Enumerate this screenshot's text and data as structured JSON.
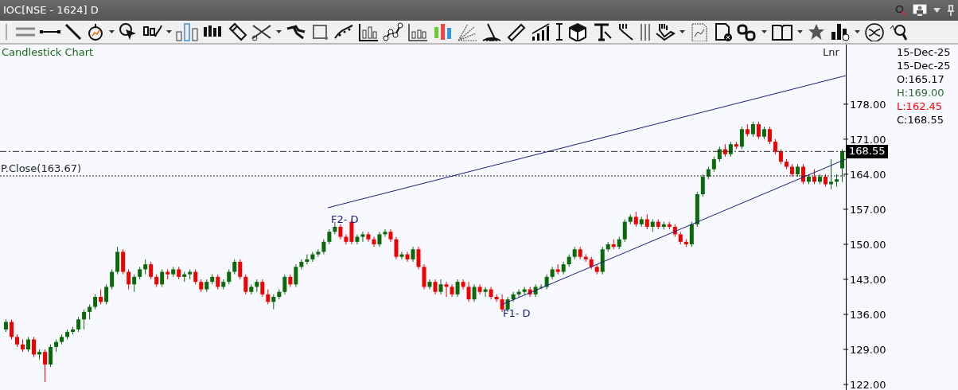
{
  "window": {
    "title": "IOC[NSE - 1624] D"
  },
  "chart": {
    "title": "Candlestick Chart",
    "scale_mode": "Lnr",
    "chart_data": {
      "type": "candlestick",
      "ylim": [
        120.9,
        189.9
      ],
      "ref_lines": [
        {
          "axis": "y",
          "value": 168.55
        },
        {
          "axis": "y",
          "value": 163.67
        }
      ],
      "yticks": [
        {
          "value": 178,
          "label": "178.00"
        },
        {
          "value": 171,
          "label": "171.00"
        },
        {
          "value": 164,
          "label": "164.00"
        },
        {
          "value": 157,
          "label": "157.00"
        },
        {
          "value": 150,
          "label": "150.00"
        },
        {
          "value": 143,
          "label": "143.00"
        },
        {
          "value": 136,
          "label": "136.00"
        },
        {
          "value": 129,
          "label": "129.00"
        },
        {
          "value": 122,
          "label": "122.00"
        }
      ],
      "ohlc": [
        [
          133,
          135,
          132.5,
          134.5
        ],
        [
          134.5,
          135,
          131,
          131.5
        ],
        [
          131.5,
          132,
          129.5,
          130
        ],
        [
          130,
          131,
          128.5,
          129
        ],
        [
          129,
          131.5,
          128.5,
          131
        ],
        [
          131,
          131.5,
          127.5,
          128
        ],
        [
          128,
          129,
          127,
          128.5
        ],
        [
          128.5,
          129,
          122.5,
          126
        ],
        [
          126,
          130,
          125.5,
          129.5
        ],
        [
          129.5,
          131,
          128.5,
          130.5
        ],
        [
          130.5,
          132,
          130,
          131.5
        ],
        [
          131.5,
          133,
          131,
          132.5
        ],
        [
          132.5,
          133.5,
          132,
          133
        ],
        [
          133,
          135.5,
          132.5,
          135
        ],
        [
          135,
          137,
          133,
          136.5
        ],
        [
          136.5,
          138,
          135,
          137.5
        ],
        [
          137.5,
          140,
          137,
          139.5
        ],
        [
          139.5,
          141,
          138,
          138.5
        ],
        [
          138.5,
          142,
          138,
          141.5
        ],
        [
          141.5,
          145,
          141,
          144.5
        ],
        [
          144.5,
          149.5,
          144,
          148.5
        ],
        [
          148.5,
          149,
          144,
          144.5
        ],
        [
          144.5,
          145,
          141,
          142
        ],
        [
          142,
          144,
          140.5,
          143.5
        ],
        [
          143.5,
          145.5,
          143,
          145
        ],
        [
          145,
          147,
          144,
          146
        ],
        [
          146,
          146.5,
          143,
          143.5
        ],
        [
          143.5,
          144,
          141.5,
          142
        ],
        [
          142,
          145,
          141.5,
          144.5
        ],
        [
          144.5,
          145,
          143,
          144
        ],
        [
          144,
          145.5,
          143.5,
          145
        ],
        [
          145,
          145.5,
          143,
          143.5
        ],
        [
          143.5,
          144.5,
          142.5,
          144
        ],
        [
          144,
          145,
          143,
          144.5
        ],
        [
          144.5,
          145,
          142,
          142.5
        ],
        [
          142.5,
          143,
          140.5,
          141
        ],
        [
          141,
          143,
          140.5,
          142.5
        ],
        [
          142.5,
          144,
          142,
          143.5
        ],
        [
          143.5,
          144,
          141,
          141.5
        ],
        [
          141.5,
          143,
          141,
          142.5
        ],
        [
          142.5,
          145,
          142,
          144.5
        ],
        [
          144.5,
          147,
          144,
          146.5
        ],
        [
          146.5,
          147,
          143,
          143.5
        ],
        [
          143.5,
          144,
          140,
          140.5
        ],
        [
          140.5,
          142,
          140,
          141.5
        ],
        [
          141.5,
          143,
          140.5,
          142.5
        ],
        [
          142.5,
          143,
          139.5,
          140
        ],
        [
          140,
          141,
          138,
          138.5
        ],
        [
          138.5,
          140,
          137,
          139.5
        ],
        [
          139.5,
          141,
          139,
          140.5
        ],
        [
          140.5,
          144,
          140,
          143.5
        ],
        [
          143.5,
          144,
          141.5,
          142
        ],
        [
          142,
          146,
          141.5,
          145.5
        ],
        [
          145.5,
          147,
          145,
          146.5
        ],
        [
          146.5,
          148,
          146,
          147
        ],
        [
          147,
          148.5,
          146.5,
          148
        ],
        [
          148,
          149,
          147.5,
          148.5
        ],
        [
          148.5,
          151,
          148,
          150.5
        ],
        [
          150.5,
          153,
          150,
          152.5
        ],
        [
          152.5,
          154.5,
          152,
          153.5
        ],
        [
          153.5,
          154,
          151,
          151.5
        ],
        [
          151.5,
          152,
          150,
          150.5
        ],
        [
          154.5,
          155,
          150,
          150.5
        ],
        [
          150.5,
          152,
          150,
          151.5
        ],
        [
          151.5,
          152.5,
          150.5,
          152
        ],
        [
          152,
          152.5,
          150.5,
          151
        ],
        [
          151,
          151.5,
          149.5,
          150
        ],
        [
          150,
          152.5,
          149.5,
          152
        ],
        [
          152,
          153,
          151.5,
          152.5
        ],
        [
          152.5,
          153,
          150.5,
          151
        ],
        [
          151,
          151.5,
          147,
          147.5
        ],
        [
          147.5,
          148.5,
          147,
          148
        ],
        [
          148,
          148.5,
          146.5,
          147
        ],
        [
          147,
          149.5,
          146.5,
          149
        ],
        [
          149,
          149.5,
          145,
          145.5
        ],
        [
          145.5,
          146,
          141,
          141.5
        ],
        [
          141.5,
          143,
          141,
          142.5
        ],
        [
          142.5,
          143,
          140,
          140.5
        ],
        [
          140.5,
          143,
          140,
          142
        ],
        [
          142,
          142.5,
          139.5,
          141.5
        ],
        [
          141.5,
          142,
          139.5,
          140
        ],
        [
          140,
          143,
          139.5,
          142.5
        ],
        [
          142.5,
          143,
          141,
          141.5
        ],
        [
          141.5,
          142.5,
          138.5,
          139
        ],
        [
          139,
          142,
          138.5,
          141.5
        ],
        [
          141.5,
          142,
          140,
          140.5
        ],
        [
          140.5,
          141.5,
          139.5,
          141
        ],
        [
          141,
          141.5,
          139,
          139.5
        ],
        [
          139.5,
          140,
          138.5,
          139
        ],
        [
          139,
          140,
          136.5,
          137
        ],
        [
          137,
          139.5,
          136.5,
          139
        ],
        [
          139,
          140.5,
          138.5,
          140
        ],
        [
          140,
          141,
          139.5,
          140.5
        ],
        [
          140.5,
          141.5,
          140,
          141
        ],
        [
          141,
          141.5,
          139.5,
          140
        ],
        [
          140,
          142,
          139.5,
          141.5
        ],
        [
          141.5,
          142,
          141,
          141.5
        ],
        [
          141.5,
          144,
          141,
          143.5
        ],
        [
          143.5,
          145.5,
          143,
          145
        ],
        [
          145,
          146,
          144,
          144.5
        ],
        [
          144.5,
          146.5,
          144,
          146
        ],
        [
          146,
          148,
          145.5,
          147.5
        ],
        [
          147.5,
          149.5,
          147,
          149
        ],
        [
          149,
          149.5,
          147,
          147.5
        ],
        [
          147.5,
          148,
          146.5,
          147
        ],
        [
          147,
          147.5,
          145,
          145.5
        ],
        [
          145.5,
          146,
          144,
          144.5
        ],
        [
          144.5,
          149.5,
          144,
          149
        ],
        [
          149,
          150.5,
          148.5,
          150
        ],
        [
          150,
          151,
          149,
          149.5
        ],
        [
          149.5,
          151.5,
          149,
          151
        ],
        [
          151,
          155,
          150.5,
          154.5
        ],
        [
          154.5,
          156,
          154,
          155.5
        ],
        [
          155.5,
          156.5,
          153.5,
          154
        ],
        [
          154,
          155.5,
          153.5,
          155
        ],
        [
          155,
          156,
          153,
          153.5
        ],
        [
          153.5,
          155,
          152.5,
          154.5
        ],
        [
          154.5,
          155,
          153,
          153.5
        ],
        [
          153.5,
          154.5,
          153,
          154
        ],
        [
          154,
          154.5,
          153,
          153.5
        ],
        [
          153.5,
          154,
          151.5,
          152
        ],
        [
          152,
          152.5,
          150,
          150.5
        ],
        [
          150.5,
          151,
          149.5,
          150
        ],
        [
          150,
          154.5,
          149.5,
          154
        ],
        [
          154,
          160.5,
          153.5,
          160
        ],
        [
          160,
          164,
          159.5,
          163.5
        ],
        [
          163.5,
          165.5,
          163,
          165
        ],
        [
          165,
          167.5,
          164.5,
          167
        ],
        [
          167,
          169.5,
          166.5,
          169
        ],
        [
          169,
          170,
          167.5,
          168
        ],
        [
          168,
          170.5,
          167.5,
          170
        ],
        [
          170,
          170.5,
          169,
          169.5
        ],
        [
          169.5,
          173.5,
          169,
          173
        ],
        [
          173,
          174,
          171.5,
          172
        ],
        [
          172,
          174.5,
          171.5,
          174
        ],
        [
          174,
          174.5,
          171,
          171.5
        ],
        [
          171.5,
          173.5,
          171,
          173
        ],
        [
          173,
          173.5,
          170,
          170.5
        ],
        [
          170.5,
          171,
          168,
          168.5
        ],
        [
          168.5,
          169,
          166,
          166.5
        ],
        [
          166.5,
          167,
          165,
          165.5
        ],
        [
          165.5,
          166,
          163.5,
          164
        ],
        [
          164,
          166,
          163.5,
          165.5
        ],
        [
          165.5,
          166,
          162,
          162.5
        ],
        [
          162.5,
          164,
          162,
          163.5
        ],
        [
          163.5,
          165,
          162,
          162.5
        ],
        [
          162.5,
          164,
          162,
          163.5
        ],
        [
          163.5,
          164,
          161.5,
          162
        ],
        [
          162,
          167,
          161,
          162.5
        ],
        [
          162.5,
          164,
          161.5,
          163
        ],
        [
          165.17,
          169,
          162.45,
          168.55
        ]
      ]
    },
    "last_price_tag": "168.55",
    "previous_close_label": "P.Close(163.67)",
    "trendline_labels": [
      {
        "text": "F2- D"
      },
      {
        "text": "F1- D"
      }
    ]
  },
  "info_panel": [
    {
      "text": "15-Dec-25",
      "color": "#000000"
    },
    {
      "text": "15-Dec-25",
      "color": "#000000"
    },
    {
      "text": "O:165.17",
      "color": "#000000"
    },
    {
      "text": "H:169.00",
      "color": "#2e6b2e"
    },
    {
      "text": "L:162.45",
      "color": "#ff0000"
    },
    {
      "text": "C:168.55",
      "color": "#000000"
    }
  ]
}
